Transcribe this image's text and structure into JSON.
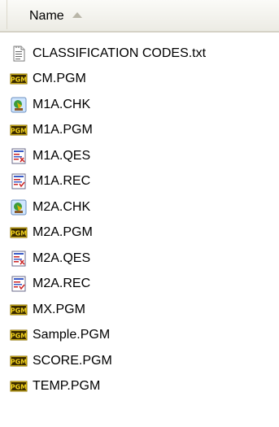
{
  "header": {
    "name_column": "Name"
  },
  "files": [
    {
      "name": "CLASSIFICATION CODES.txt",
      "icon": "text-file-icon"
    },
    {
      "name": "CM.PGM",
      "icon": "pgm-file-icon"
    },
    {
      "name": "M1A.CHK",
      "icon": "chk-file-icon"
    },
    {
      "name": "M1A.PGM",
      "icon": "pgm-file-icon"
    },
    {
      "name": "M1A.QES",
      "icon": "qes-file-icon"
    },
    {
      "name": "M1A.REC",
      "icon": "rec-file-icon"
    },
    {
      "name": "M2A.CHK",
      "icon": "chk-file-icon"
    },
    {
      "name": "M2A.PGM",
      "icon": "pgm-file-icon"
    },
    {
      "name": "M2A.QES",
      "icon": "qes-file-icon"
    },
    {
      "name": "M2A.REC",
      "icon": "rec-file-icon"
    },
    {
      "name": "MX.PGM",
      "icon": "pgm-file-icon"
    },
    {
      "name": "Sample.PGM",
      "icon": "pgm-file-icon"
    },
    {
      "name": "SCORE.PGM",
      "icon": "pgm-file-icon"
    },
    {
      "name": "TEMP.PGM",
      "icon": "pgm-file-icon"
    }
  ]
}
